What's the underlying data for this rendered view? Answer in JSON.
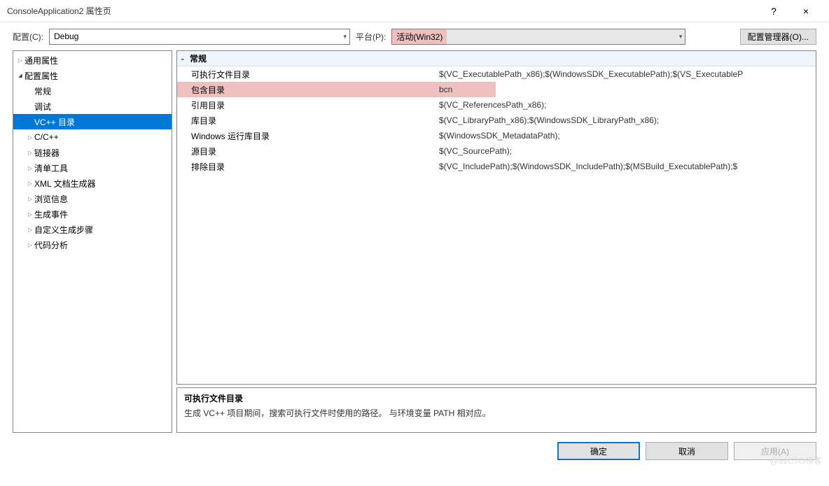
{
  "window": {
    "title": "ConsoleApplication2 属性页",
    "help_symbol": "?",
    "close_symbol": "×"
  },
  "toolbar": {
    "config_label": "配置(C):",
    "config_value": "Debug",
    "platform_label": "平台(P):",
    "platform_value": "活动(Win32)",
    "config_mgr_btn": "配置管理器(O)..."
  },
  "tree": {
    "common": "通用属性",
    "config": "配置属性",
    "general": "常规",
    "debugging": "调试",
    "vcdirs": "VC++ 目录",
    "ccpp": "C/C++",
    "linker": "链接器",
    "manifest": "清单工具",
    "xml": "XML 文档生成器",
    "browse": "浏览信息",
    "build_events": "生成事件",
    "custom_build": "自定义生成步骤",
    "code_analysis": "代码分析"
  },
  "props": {
    "section": "常规",
    "rows": [
      {
        "name": "可执行文件目录",
        "value": "$(VC_ExecutablePath_x86);$(WindowsSDK_ExecutablePath);$(VS_ExecutableP"
      },
      {
        "name": "包含目录",
        "value": "bcn"
      },
      {
        "name": "引用目录",
        "value": "$(VC_ReferencesPath_x86);"
      },
      {
        "name": "库目录",
        "value": "$(VC_LibraryPath_x86);$(WindowsSDK_LibraryPath_x86);"
      },
      {
        "name": "Windows 运行库目录",
        "value": "$(WindowsSDK_MetadataPath);"
      },
      {
        "name": "源目录",
        "value": "$(VC_SourcePath);"
      },
      {
        "name": "排除目录",
        "value": "$(VC_IncludePath);$(WindowsSDK_IncludePath);$(MSBuild_ExecutablePath);$"
      }
    ]
  },
  "description": {
    "title": "可执行文件目录",
    "text": "生成 VC++ 项目期间，搜索可执行文件时使用的路径。 与环境变量 PATH 相对应。"
  },
  "footer": {
    "ok": "确定",
    "cancel": "取消",
    "apply": "应用(A)"
  },
  "watermark": "@51CTO博客"
}
